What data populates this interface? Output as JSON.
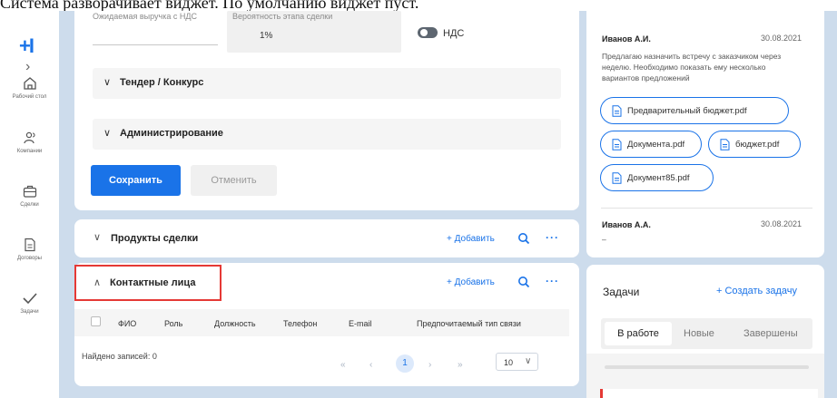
{
  "caption": "Система разворачивает виджет. По умолчанию виджет пуст.",
  "nav": {
    "logo": "+I",
    "items": [
      {
        "label": "Рабочий стол",
        "icon": "home-icon"
      },
      {
        "label": "Компании",
        "icon": "people-icon"
      },
      {
        "label": "Сделки",
        "icon": "briefcase-icon"
      },
      {
        "label": "Договоры",
        "icon": "document-icon"
      },
      {
        "label": "Задачи",
        "icon": "check-icon"
      }
    ]
  },
  "deal_form": {
    "revenue_label": "Ожидаемая выручка с НДС",
    "revenue_value": "",
    "probability_label": "Вероятность этапа сделки",
    "probability_value": "1%",
    "vat_label": "НДС",
    "vat_enabled": false,
    "sections": [
      "Тендер / Конкурс",
      "Администрирование"
    ],
    "save_label": "Сохранить",
    "cancel_label": "Отменить"
  },
  "products_widget": {
    "title": "Продукты сделки",
    "add_label": "+ Добавить",
    "expanded": false
  },
  "contacts_widget": {
    "title": "Контактные лица",
    "add_label": "+ Добавить",
    "expanded": true,
    "columns": [
      "ФИО",
      "Роль",
      "Должность",
      "Телефон",
      "E-mail",
      "Предпочитаемый тип связи"
    ],
    "rows": [],
    "found_label": "Найдено записей: 0",
    "pagination": {
      "first": "«",
      "prev": "‹",
      "current": "1",
      "next": "›",
      "last": "»",
      "page_size": "10"
    }
  },
  "feed": {
    "entries": [
      {
        "author": "Иванов А.И.",
        "date": "30.08.2021",
        "text": "Предлагаю назначить встречу с заказчиком через неделю. Необходимо показать ему несколько вариантов предложений",
        "files": [
          "Предварительный бюджет.pdf",
          "Документа.pdf",
          "бюджет.pdf",
          "Документ85.pdf"
        ]
      },
      {
        "author": "Иванов А.А.",
        "date": "30.08.2021",
        "text": "–"
      }
    ]
  },
  "tasks": {
    "title": "Задачи",
    "create_label": "+ Создать задачу",
    "tabs": [
      "В работе",
      "Новые",
      "Завершены"
    ],
    "active_tab": "В работе"
  },
  "colors": {
    "accent": "#1a73e8",
    "highlight": "#e53935",
    "background": "#cddcec"
  }
}
